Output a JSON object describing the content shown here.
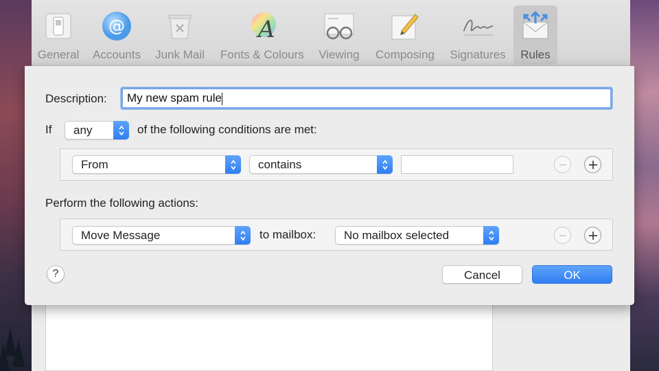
{
  "toolbar": {
    "items": [
      {
        "label": "General",
        "icon": "general-switch-icon"
      },
      {
        "label": "Accounts",
        "icon": "at-sign-icon"
      },
      {
        "label": "Junk Mail",
        "icon": "trash-bin-icon"
      },
      {
        "label": "Fonts & Colours",
        "icon": "font-colour-icon"
      },
      {
        "label": "Viewing",
        "icon": "glasses-icon"
      },
      {
        "label": "Composing",
        "icon": "pencil-paper-icon"
      },
      {
        "label": "Signatures",
        "icon": "signature-icon"
      },
      {
        "label": "Rules",
        "icon": "rules-envelope-icon"
      }
    ],
    "selected": "Rules"
  },
  "rule_sheet": {
    "description_label": "Description:",
    "description_value": "My new spam rule",
    "if_label": "If",
    "match_select": "any",
    "conditions_text": "of the following conditions are met:",
    "condition": {
      "field": "From",
      "operator": "contains",
      "value": ""
    },
    "actions_label": "Perform the following actions:",
    "action": {
      "type": "Move Message",
      "to_label": "to mailbox:",
      "mailbox": "No mailbox selected"
    },
    "help_label": "?",
    "cancel_label": "Cancel",
    "ok_label": "OK"
  },
  "colors": {
    "accent": "#2f7ef2",
    "focus_ring": "#7aa7e6"
  }
}
